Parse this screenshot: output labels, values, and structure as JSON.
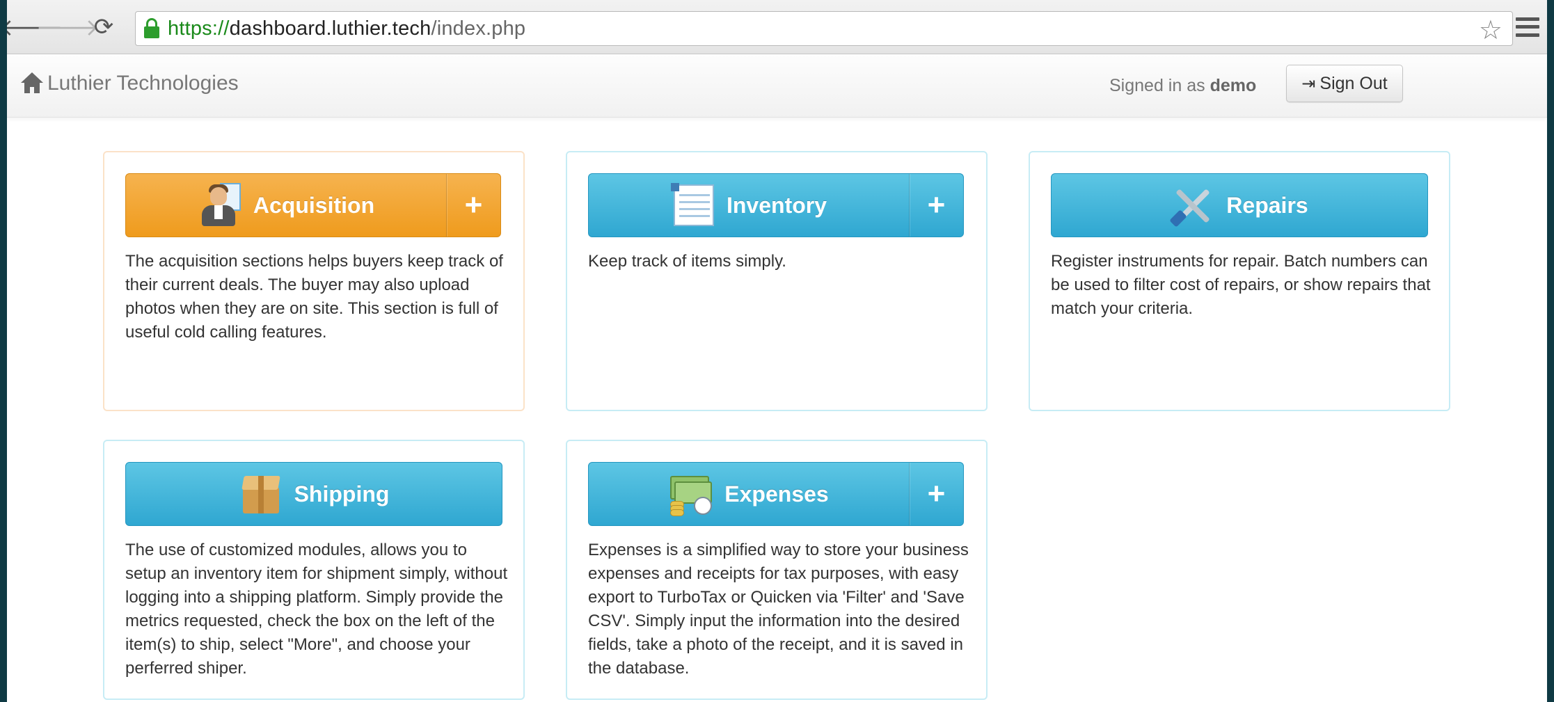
{
  "browser": {
    "url_scheme": "https://",
    "url_host": "dashboard.luthier.tech",
    "url_path": "/index.php",
    "back_glyph": "🡐",
    "forward_glyph": "🡒",
    "reload_glyph": "⟳",
    "star_glyph": "☆"
  },
  "navbar": {
    "brand": "Luthier Technologies",
    "signed_in_prefix": "Signed in as",
    "username": "demo",
    "signout_label": "Sign Out"
  },
  "cards": [
    {
      "title": "Acquisition",
      "icon": "businessman-icon",
      "color": "#ef9b1d",
      "has_add": true,
      "add_label": "+",
      "text": "The acquisition sections helps buyers keep track of their current deals. The buyer may also upload photos when they are on site. This section is full of useful cold calling features."
    },
    {
      "title": "Inventory",
      "icon": "list-icon",
      "color": "#2fa7d1",
      "has_add": true,
      "add_label": "+",
      "text": "Keep track of items simply."
    },
    {
      "title": "Repairs",
      "icon": "tools-icon",
      "color": "#2fa7d1",
      "has_add": false,
      "text": "Register instruments for repair. Batch numbers can be used to filter cost of repairs, or show repairs that match your criteria."
    },
    {
      "title": "Shipping",
      "icon": "box-icon",
      "color": "#2fa7d1",
      "has_add": false,
      "text": "The use of customized modules, allows you to setup an inventory item for shipment simply, without logging into a shipping platform. Simply provide the metrics requested, check the box on the left of the item(s) to ship, select \"More\", and choose your perferred shiper."
    },
    {
      "title": "Expenses",
      "icon": "money-icon",
      "color": "#2fa7d1",
      "has_add": true,
      "add_label": "+",
      "text": "Expenses is a simplified way to store your business expenses and receipts for tax purposes, with easy export to TurboTax or Quicken via 'Filter' and 'Save CSV'. Simply input the information into the desired fields, take a photo of the receipt, and it is saved in the database."
    }
  ]
}
